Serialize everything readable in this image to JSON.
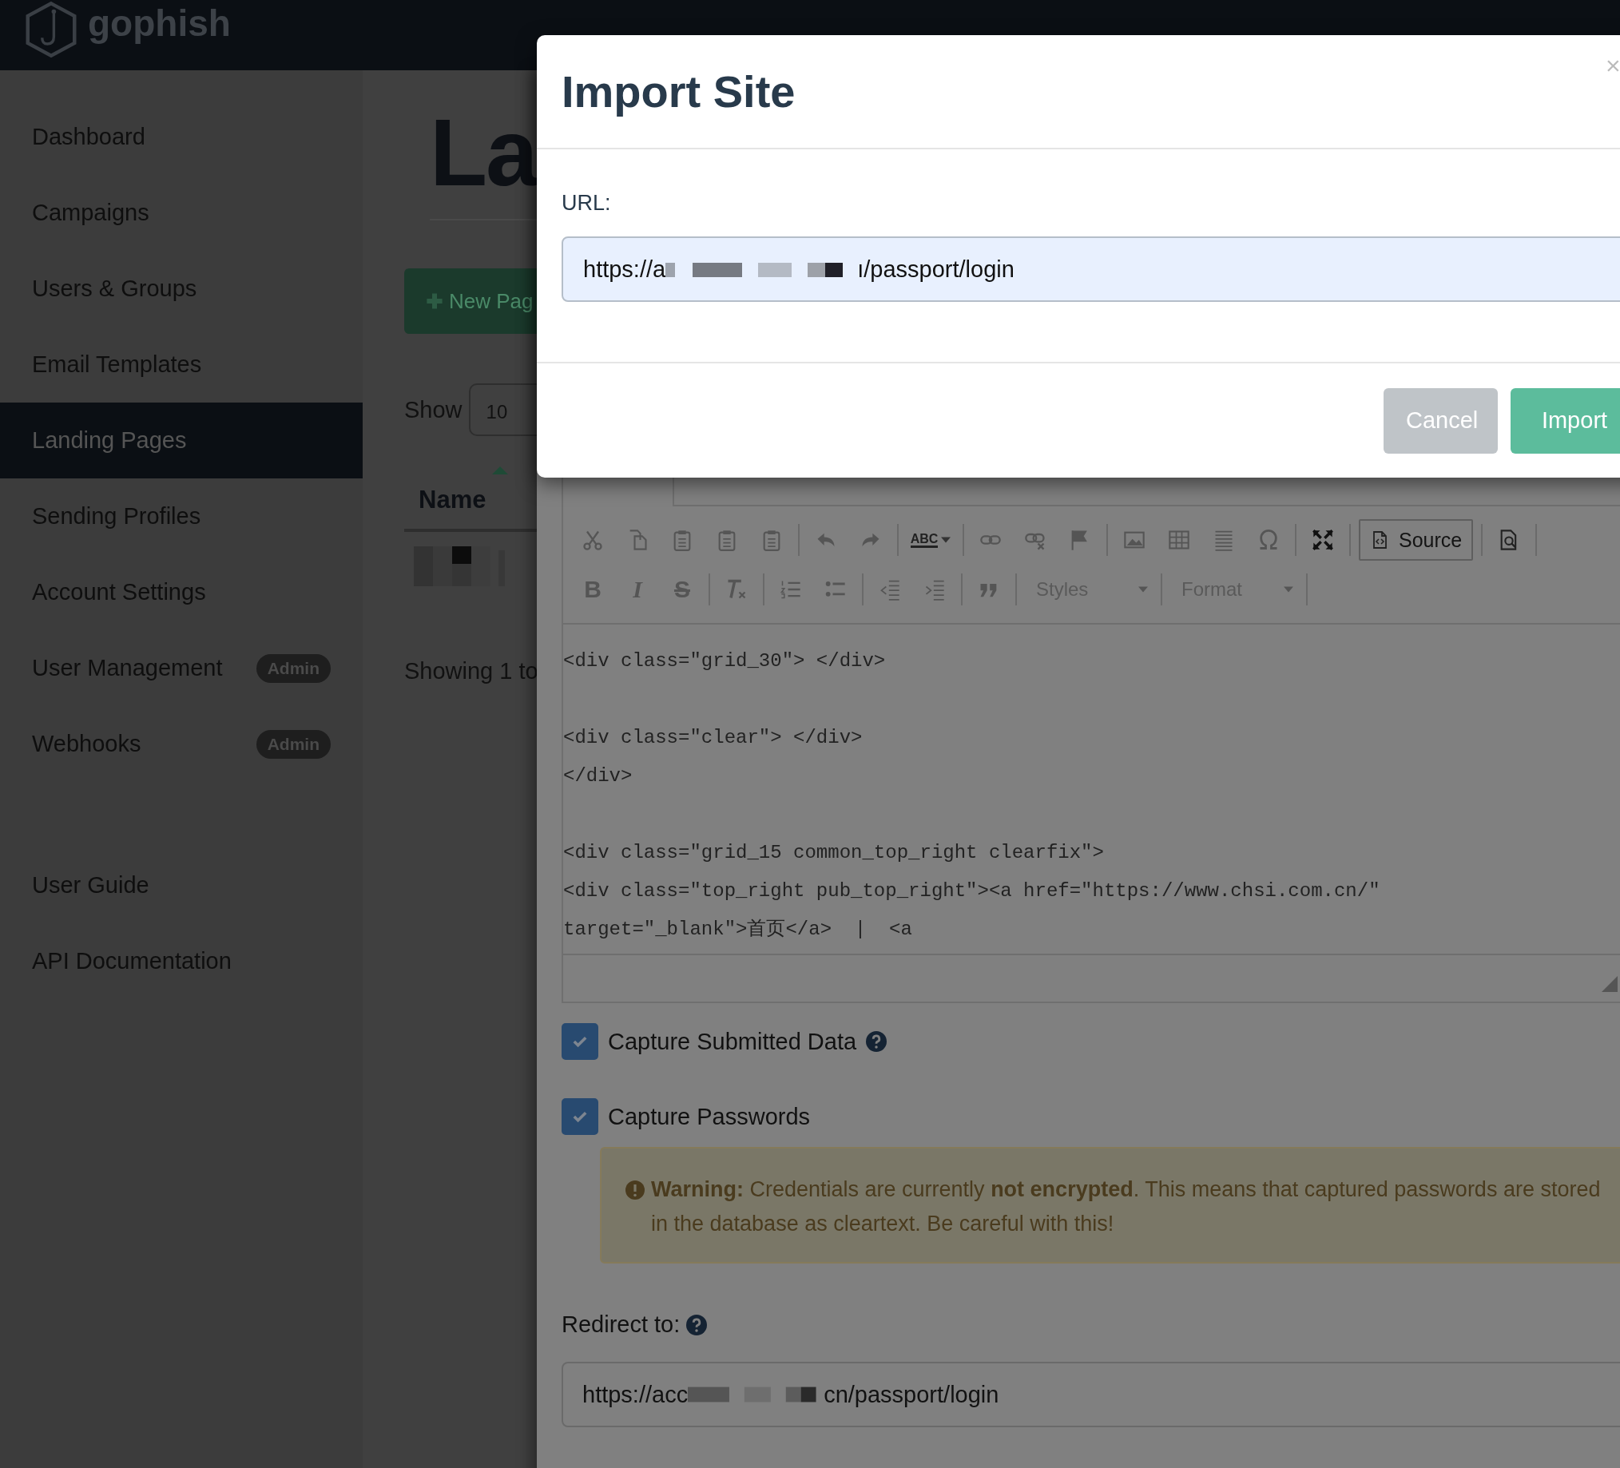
{
  "navbar": {
    "brand": "gophish"
  },
  "sidebar": {
    "items": [
      {
        "label": "Dashboard",
        "selected": false
      },
      {
        "label": "Campaigns",
        "selected": false
      },
      {
        "label": "Users & Groups",
        "selected": false
      },
      {
        "label": "Email Templates",
        "selected": false
      },
      {
        "label": "Landing Pages",
        "selected": true
      },
      {
        "label": "Sending Profiles",
        "selected": false
      },
      {
        "label": "Account Settings",
        "selected": false
      },
      {
        "label": "User Management",
        "selected": false,
        "badge": "Admin"
      },
      {
        "label": "Webhooks",
        "selected": false,
        "badge": "Admin"
      }
    ],
    "links": [
      "User Guide",
      "API Documentation"
    ]
  },
  "page": {
    "title": "La",
    "new_button": "New Pag",
    "show_label": "Show",
    "page_size": "10",
    "columns": [
      "Name"
    ],
    "footer": "Showing 1 to"
  },
  "edit_modal": {
    "toolbar": {
      "spellcheck": "ABC",
      "source": "Source",
      "bold": "B",
      "italic": "I",
      "strike": "S",
      "styles": "Styles",
      "format": "Format"
    },
    "code_lines": [
      {
        "kind": "code",
        "text": "<div class=\"grid_30\"> </div>"
      },
      {
        "kind": "blank"
      },
      {
        "kind": "code",
        "text": "<div class=\"clear\"> </div>"
      },
      {
        "kind": "code",
        "text": "</div>"
      },
      {
        "kind": "blank"
      },
      {
        "kind": "code",
        "text": "<div class=\"grid_15 common_top_right clearfix\">"
      },
      {
        "kind": "code",
        "text": "<div class=\"top_right pub_top_right\"><a href=\"https://www.chsi.com.cn/\""
      },
      {
        "kind": "code",
        "text": "target=\"_blank\">首页</a>  |  <a"
      }
    ],
    "options": [
      {
        "label": "Capture Submitted Data",
        "checked": true,
        "help": true
      },
      {
        "label": "Capture Passwords",
        "checked": true,
        "help": false
      }
    ],
    "warning": "**Warning:** Credentials are currently **not encrypted**. This means that captured passwords are stored in the database as cleartext. Be careful with this!",
    "redirect": {
      "label": "Redirect to:",
      "value_start": "https://acc",
      "value_end": "cn/passport/login"
    }
  },
  "import_modal": {
    "title": "Import Site",
    "close": "×",
    "url_label": "URL:",
    "url_start": "https://a",
    "url_end": "ı/passport/login",
    "buttons": [
      {
        "label": "Cancel",
        "kind": "secondary"
      },
      {
        "label": "Import",
        "kind": "primary"
      }
    ]
  }
}
